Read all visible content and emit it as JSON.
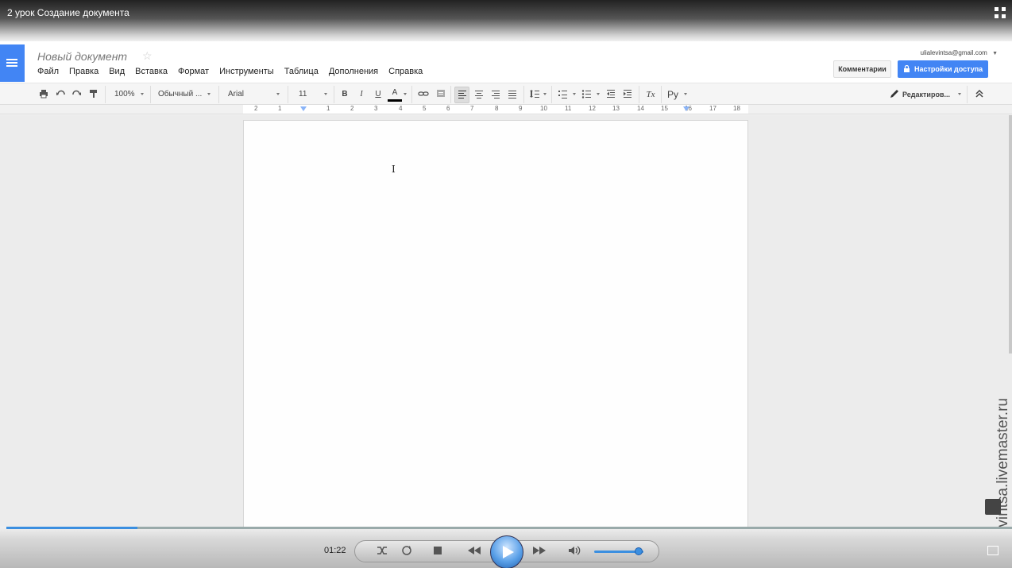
{
  "video": {
    "title": "2 урок Создание документа",
    "time": "01:22",
    "progress_fraction": 0.13,
    "volume_fraction": 0.9
  },
  "doc": {
    "title": "Новый документ",
    "account": "ulialevintsa@gmail.com",
    "comments_label": "Комментарии",
    "share_label": "Настройки доступа",
    "menu": [
      "Файл",
      "Правка",
      "Вид",
      "Вставка",
      "Формат",
      "Инструменты",
      "Таблица",
      "Дополнения",
      "Справка"
    ]
  },
  "toolbar": {
    "zoom": "100%",
    "style": "Обычный ...",
    "font": "Arial",
    "size": "11",
    "bold": "B",
    "italic": "I",
    "underline": "U",
    "text_color": "A",
    "clear_format": "Tx",
    "input_tools": "Ру",
    "mode": "Редактиров..."
  },
  "ruler": {
    "numbers": [
      "2",
      "1",
      "1",
      "2",
      "3",
      "4",
      "5",
      "6",
      "7",
      "8",
      "9",
      "10",
      "11",
      "12",
      "13",
      "14",
      "15",
      "16",
      "17",
      "18"
    ]
  },
  "watermark": "ulialevintsa.livemaster.ru",
  "colors": {
    "docs_blue": "#4285f4",
    "player_blue": "#3b8fe0"
  },
  "icons": [
    "print-icon",
    "undo-icon",
    "redo-icon",
    "paint-format-icon",
    "link-icon",
    "comment-icon",
    "align-left-icon",
    "align-center-icon",
    "align-right-icon",
    "justify-icon",
    "line-spacing-icon",
    "numbered-list-icon",
    "bulleted-list-icon",
    "decrease-indent-icon",
    "increase-indent-icon",
    "pencil-icon",
    "collapse-icon"
  ]
}
